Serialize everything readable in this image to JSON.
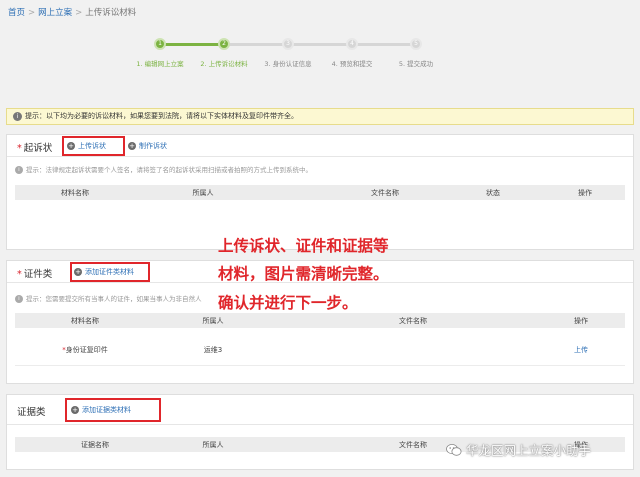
{
  "breadcrumb": {
    "home": "首页",
    "sep": ">",
    "section": "网上立案",
    "current": "上传诉讼材料"
  },
  "steps": [
    {
      "num": "1",
      "label": "1. 编辑网上立案",
      "state": "done"
    },
    {
      "num": "2",
      "label": "2. 上传诉讼材料",
      "state": "done"
    },
    {
      "num": "3",
      "label": "3. 身份认证信息",
      "state": "todo"
    },
    {
      "num": "4",
      "label": "4. 预览和提交",
      "state": "todo"
    },
    {
      "num": "5",
      "label": "5. 提交成功",
      "state": "todo"
    }
  ],
  "notice": {
    "icon": "info-icon",
    "text": "提示：以下均为必要的诉讼材料，如果您要到法院，请将以下实体材料及复印件带齐全。"
  },
  "complaint": {
    "required_mark": "*",
    "title": "起诉状",
    "upload_label": "上传诉状",
    "make_label": "制作诉状",
    "tip": "提示：法律规定起诉状需要个人签名，请将签了名的起诉状采用扫描或者拍照的方式上传到系统中。",
    "columns": [
      "材料名称",
      "所属人",
      "文件名称",
      "状态",
      "操作"
    ]
  },
  "certificates": {
    "required_mark": "*",
    "title": "证件类",
    "add_label": "添加证件类材料",
    "tip": "提示：您需要提交所有当事人的证件，如果当事人为非自然人",
    "columns": [
      "材料名称",
      "所属人",
      "文件名称",
      "操作"
    ],
    "rows": [
      {
        "required": "*",
        "name": "身份证复印件",
        "owner": "运维3",
        "file": "",
        "action": "上传"
      }
    ]
  },
  "evidence": {
    "title": "证据类",
    "add_label": "添加证据类材料",
    "columns": [
      "证据名称",
      "所属人",
      "文件名称",
      "操作"
    ]
  },
  "annotation": {
    "line1": "上传诉状、证件和证据等",
    "line2": "材料，图片需清晰完整。",
    "line3": "确认并进行下一步。",
    "color": "#e0262b"
  },
  "watermark": {
    "icon": "wechat-icon",
    "text": "华龙区网上立案小助手"
  }
}
